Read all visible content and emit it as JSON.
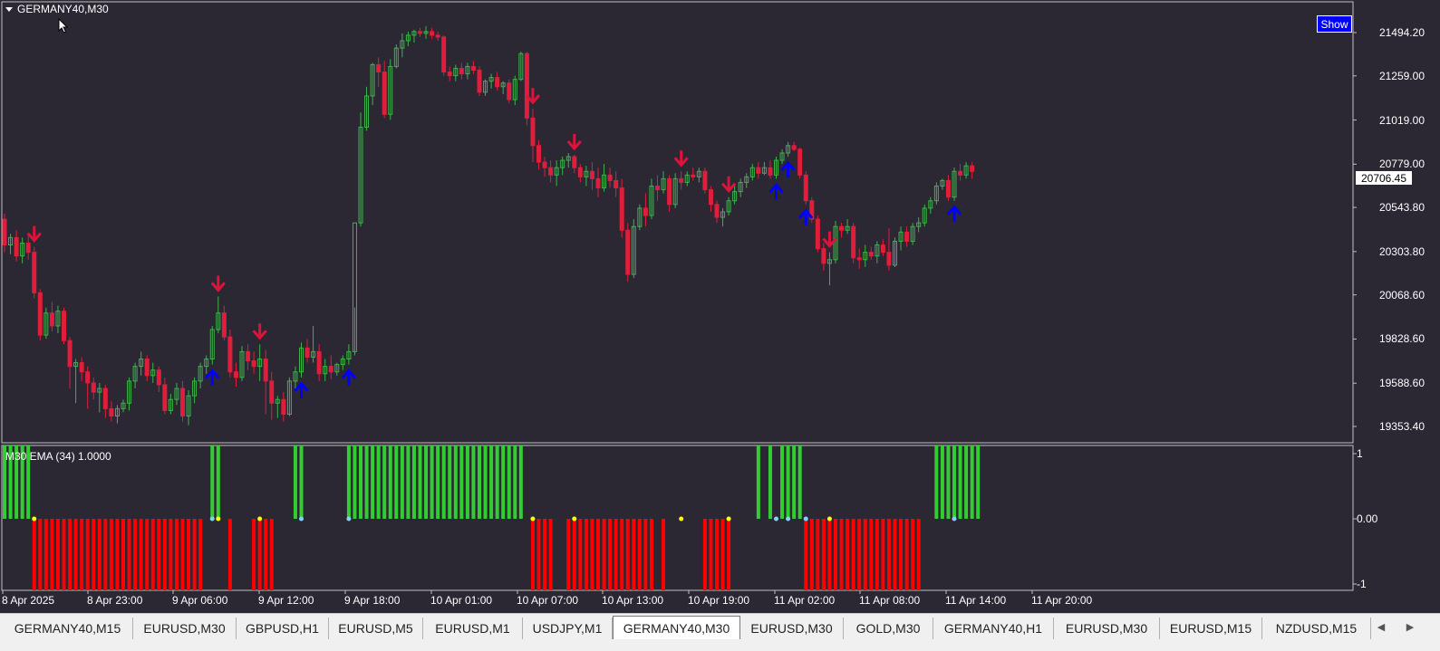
{
  "main_chart": {
    "symbol_title": "GERMANY40,M30",
    "show_button": "Show",
    "price_labels": [
      "21494.20",
      "21259.00",
      "21019.00",
      "20779.00",
      "20543.80",
      "20303.80",
      "20068.60",
      "19828.60",
      "19588.60",
      "19353.40"
    ],
    "current_price": "20706.45",
    "bull_color": "#3cb44b",
    "bear_color": "#e01e3c",
    "arrow_down_color": "#dc143c",
    "arrow_up_color": "#0000ff"
  },
  "indicator": {
    "title": "M30 EMA (34) 1.0000",
    "labels": [
      "1",
      "0.00",
      "-1"
    ],
    "green_color": "#32cd32",
    "red_color": "#ff0000"
  },
  "time_axis": [
    "8 Apr 2025",
    "8 Apr 23:00",
    "9 Apr 06:00",
    "9 Apr 12:00",
    "9 Apr 18:00",
    "10 Apr 01:00",
    "10 Apr 07:00",
    "10 Apr 13:00",
    "10 Apr 19:00",
    "11 Apr 02:00",
    "11 Apr 08:00",
    "11 Apr 14:00",
    "11 Apr 20:00"
  ],
  "tabs": [
    {
      "label": "GERMANY40,M15",
      "active": false
    },
    {
      "label": "EURUSD,M30",
      "active": false
    },
    {
      "label": "GBPUSD,H1",
      "active": false
    },
    {
      "label": "EURUSD,M5",
      "active": false
    },
    {
      "label": "EURUSD,M1",
      "active": false
    },
    {
      "label": "USDJPY,M1",
      "active": false
    },
    {
      "label": "GERMANY40,M30",
      "active": true
    },
    {
      "label": "EURUSD,M30",
      "active": false
    },
    {
      "label": "GOLD,M30",
      "active": false
    },
    {
      "label": "GERMANY40,H1",
      "active": false
    },
    {
      "label": "EURUSD,M30",
      "active": false
    },
    {
      "label": "EURUSD,M15",
      "active": false
    },
    {
      "label": "NZDUSD,M15",
      "active": false
    }
  ],
  "candles": [
    [
      20480,
      20510,
      20300,
      20340
    ],
    [
      20340,
      20400,
      20290,
      20380
    ],
    [
      20380,
      20420,
      20250,
      20280
    ],
    [
      20280,
      20380,
      20240,
      20350
    ],
    [
      20350,
      20400,
      20260,
      20300
    ],
    [
      20300,
      20330,
      20050,
      20080
    ],
    [
      20080,
      20100,
      19820,
      19850
    ],
    [
      19850,
      20000,
      19830,
      19970
    ],
    [
      19970,
      20030,
      19870,
      19900
    ],
    [
      19900,
      20010,
      19860,
      19980
    ],
    [
      19980,
      20000,
      19800,
      19820
    ],
    [
      19820,
      19840,
      19560,
      19680
    ],
    [
      19680,
      19720,
      19480,
      19700
    ],
    [
      19700,
      19730,
      19600,
      19650
    ],
    [
      19650,
      19680,
      19450,
      19590
    ],
    [
      19590,
      19620,
      19500,
      19540
    ],
    [
      19540,
      19590,
      19430,
      19560
    ],
    [
      19560,
      19580,
      19400,
      19450
    ],
    [
      19450,
      19490,
      19380,
      19410
    ],
    [
      19410,
      19470,
      19370,
      19450
    ],
    [
      19450,
      19500,
      19430,
      19480
    ],
    [
      19480,
      19620,
      19440,
      19600
    ],
    [
      19600,
      19700,
      19560,
      19680
    ],
    [
      19680,
      19760,
      19630,
      19720
    ],
    [
      19720,
      19740,
      19600,
      19630
    ],
    [
      19630,
      19700,
      19590,
      19660
    ],
    [
      19660,
      19680,
      19540,
      19580
    ],
    [
      19580,
      19620,
      19420,
      19440
    ],
    [
      19440,
      19530,
      19420,
      19500
    ],
    [
      19500,
      19590,
      19470,
      19560
    ],
    [
      19560,
      19600,
      19380,
      19410
    ],
    [
      19410,
      19550,
      19360,
      19520
    ],
    [
      19520,
      19620,
      19480,
      19600
    ],
    [
      19600,
      19700,
      19560,
      19680
    ],
    [
      19680,
      19740,
      19640,
      19720
    ],
    [
      19720,
      19900,
      19690,
      19880
    ],
    [
      19880,
      20060,
      19860,
      19970
    ],
    [
      19970,
      20010,
      19820,
      19840
    ],
    [
      19840,
      19880,
      19620,
      19650
    ],
    [
      19650,
      19700,
      19570,
      19620
    ],
    [
      19620,
      19790,
      19600,
      19760
    ],
    [
      19760,
      19800,
      19660,
      19710
    ],
    [
      19710,
      19760,
      19640,
      19680
    ],
    [
      19680,
      19800,
      19600,
      19720
    ],
    [
      19720,
      19770,
      19420,
      19600
    ],
    [
      19600,
      19650,
      19390,
      19480
    ],
    [
      19480,
      19520,
      19400,
      19500
    ],
    [
      19500,
      19540,
      19380,
      19420
    ],
    [
      19420,
      19620,
      19410,
      19600
    ],
    [
      19600,
      19680,
      19560,
      19650
    ],
    [
      19650,
      19810,
      19620,
      19780
    ],
    [
      19780,
      19830,
      19700,
      19730
    ],
    [
      19730,
      19900,
      19700,
      19760
    ],
    [
      19760,
      19800,
      19600,
      19640
    ],
    [
      19640,
      19720,
      19600,
      19680
    ],
    [
      19680,
      19740,
      19610,
      19650
    ],
    [
      19650,
      19700,
      19630,
      19690
    ],
    [
      19690,
      19740,
      19660,
      19720
    ],
    [
      19720,
      19800,
      19690,
      19760
    ],
    [
      19760,
      20000,
      19740,
      20460
    ],
    [
      20460,
      21060,
      20440,
      20980
    ],
    [
      20980,
      21200,
      20960,
      21150
    ],
    [
      21150,
      21330,
      21100,
      21320
    ],
    [
      21320,
      21360,
      21200,
      21280
    ],
    [
      21280,
      21340,
      21030,
      21050
    ],
    [
      21050,
      21350,
      21020,
      21310
    ],
    [
      21310,
      21430,
      21300,
      21410
    ],
    [
      21410,
      21490,
      21360,
      21450
    ],
    [
      21450,
      21500,
      21420,
      21480
    ],
    [
      21480,
      21510,
      21440,
      21500
    ],
    [
      21500,
      21520,
      21470,
      21490
    ],
    [
      21490,
      21530,
      21460,
      21500
    ],
    [
      21500,
      21520,
      21460,
      21480
    ],
    [
      21480,
      21500,
      21450,
      21470
    ],
    [
      21470,
      21480,
      21260,
      21280
    ],
    [
      21280,
      21310,
      21230,
      21260
    ],
    [
      21260,
      21320,
      21230,
      21300
    ],
    [
      21300,
      21330,
      21240,
      21270
    ],
    [
      21270,
      21330,
      21240,
      21310
    ],
    [
      21310,
      21340,
      21270,
      21290
    ],
    [
      21290,
      21310,
      21150,
      21170
    ],
    [
      21170,
      21240,
      21150,
      21230
    ],
    [
      21230,
      21270,
      21190,
      21250
    ],
    [
      21250,
      21280,
      21180,
      21200
    ],
    [
      21200,
      21230,
      21160,
      21220
    ],
    [
      21220,
      21240,
      21110,
      21130
    ],
    [
      21130,
      21260,
      21100,
      21240
    ],
    [
      21240,
      21390,
      21230,
      21380
    ],
    [
      21380,
      21390,
      20990,
      21030
    ],
    [
      21030,
      21080,
      20790,
      20880
    ],
    [
      20880,
      20910,
      20750,
      20790
    ],
    [
      20790,
      20820,
      20710,
      20760
    ],
    [
      20760,
      20800,
      20680,
      20720
    ],
    [
      20720,
      20800,
      20660,
      20760
    ],
    [
      20760,
      20820,
      20720,
      20800
    ],
    [
      20800,
      20840,
      20760,
      20820
    ],
    [
      20820,
      20830,
      20730,
      20760
    ],
    [
      20760,
      20780,
      20680,
      20710
    ],
    [
      20710,
      20770,
      20660,
      20740
    ],
    [
      20740,
      20790,
      20640,
      20700
    ],
    [
      20700,
      20760,
      20600,
      20650
    ],
    [
      20650,
      20780,
      20630,
      20720
    ],
    [
      20720,
      20760,
      20650,
      20690
    ],
    [
      20690,
      20740,
      20600,
      20650
    ],
    [
      20650,
      20700,
      20380,
      20420
    ],
    [
      20420,
      20460,
      20140,
      20180
    ],
    [
      20180,
      20480,
      20160,
      20440
    ],
    [
      20440,
      20560,
      20420,
      20540
    ],
    [
      20540,
      20620,
      20440,
      20500
    ],
    [
      20500,
      20700,
      20480,
      20660
    ],
    [
      20660,
      20720,
      20580,
      20640
    ],
    [
      20640,
      20740,
      20620,
      20700
    ],
    [
      20700,
      20720,
      20520,
      20560
    ],
    [
      20560,
      20730,
      20540,
      20700
    ],
    [
      20700,
      20740,
      20640,
      20680
    ],
    [
      20680,
      20740,
      20660,
      20720
    ],
    [
      20720,
      20760,
      20690,
      20710
    ],
    [
      20710,
      20760,
      20680,
      20740
    ],
    [
      20740,
      20760,
      20620,
      20640
    ],
    [
      20640,
      20660,
      20520,
      20560
    ],
    [
      20560,
      20580,
      20460,
      20490
    ],
    [
      20490,
      20540,
      20440,
      20520
    ],
    [
      20520,
      20600,
      20500,
      20580
    ],
    [
      20580,
      20660,
      20560,
      20630
    ],
    [
      20630,
      20700,
      20600,
      20680
    ],
    [
      20680,
      20730,
      20650,
      20710
    ],
    [
      20710,
      20780,
      20690,
      20760
    ],
    [
      20760,
      20790,
      20700,
      20730
    ],
    [
      20730,
      20790,
      20720,
      20760
    ],
    [
      20760,
      20800,
      20700,
      20720
    ],
    [
      20720,
      20820,
      20700,
      20800
    ],
    [
      20800,
      20860,
      20780,
      20840
    ],
    [
      20840,
      20900,
      20820,
      20880
    ],
    [
      20880,
      20900,
      20850,
      20860
    ],
    [
      20860,
      20870,
      20700,
      20720
    ],
    [
      20720,
      20740,
      20560,
      20580
    ],
    [
      20580,
      20600,
      20460,
      20480
    ],
    [
      20480,
      20500,
      20300,
      20320
    ],
    [
      20320,
      20350,
      20200,
      20240
    ],
    [
      20240,
      20300,
      20120,
      20260
    ],
    [
      20260,
      20470,
      20240,
      20440
    ],
    [
      20440,
      20460,
      20380,
      20420
    ],
    [
      20420,
      20480,
      20400,
      20440
    ],
    [
      20440,
      20460,
      20240,
      20270
    ],
    [
      20270,
      20320,
      20210,
      20260
    ],
    [
      20260,
      20340,
      20220,
      20300
    ],
    [
      20300,
      20330,
      20260,
      20280
    ],
    [
      20280,
      20360,
      20240,
      20340
    ],
    [
      20340,
      20370,
      20280,
      20300
    ],
    [
      20300,
      20430,
      20200,
      20230
    ],
    [
      20230,
      20380,
      20220,
      20360
    ],
    [
      20360,
      20440,
      20310,
      20410
    ],
    [
      20410,
      20440,
      20330,
      20360
    ],
    [
      20360,
      20460,
      20340,
      20440
    ],
    [
      20440,
      20490,
      20410,
      20460
    ],
    [
      20460,
      20560,
      20440,
      20540
    ],
    [
      20540,
      20600,
      20510,
      20580
    ],
    [
      20580,
      20680,
      20560,
      20660
    ],
    [
      20660,
      20700,
      20640,
      20690
    ],
    [
      20690,
      20720,
      20580,
      20600
    ],
    [
      20600,
      20760,
      20580,
      20740
    ],
    [
      20740,
      20780,
      20690,
      20720
    ],
    [
      20720,
      20790,
      20700,
      20770
    ],
    [
      20770,
      20790,
      20700,
      20740
    ]
  ],
  "arrows": [
    {
      "i": 5,
      "dir": "down"
    },
    {
      "i": 36,
      "dir": "down"
    },
    {
      "i": 43,
      "dir": "down"
    },
    {
      "i": 35,
      "dir": "up"
    },
    {
      "i": 50,
      "dir": "up"
    },
    {
      "i": 58,
      "dir": "up"
    },
    {
      "i": 89,
      "dir": "down"
    },
    {
      "i": 96,
      "dir": "down"
    },
    {
      "i": 114,
      "dir": "down"
    },
    {
      "i": 122,
      "dir": "down"
    },
    {
      "i": 130,
      "dir": "up"
    },
    {
      "i": 132,
      "dir": "up"
    },
    {
      "i": 135,
      "dir": "up"
    },
    {
      "i": 139,
      "dir": "down"
    },
    {
      "i": 160,
      "dir": "up"
    }
  ],
  "histogram": [
    1,
    1,
    1,
    1,
    1,
    -1,
    -1,
    -1,
    -1,
    -1,
    -1,
    -1,
    -1,
    -1,
    -1,
    -1,
    -1,
    -1,
    -1,
    -1,
    -1,
    -1,
    -1,
    -1,
    -1,
    -1,
    -1,
    -1,
    -1,
    -1,
    -1,
    -1,
    -1,
    -1,
    0,
    1,
    1,
    0,
    -1,
    0,
    0,
    0,
    -1,
    -1,
    -1,
    -1,
    0,
    0,
    0,
    1,
    1,
    0,
    0,
    0,
    0,
    0,
    0,
    0,
    1,
    1,
    1,
    1,
    1,
    1,
    1,
    1,
    1,
    1,
    1,
    1,
    1,
    1,
    1,
    1,
    1,
    1,
    1,
    1,
    1,
    1,
    1,
    1,
    1,
    1,
    1,
    1,
    1,
    1,
    0,
    -1,
    -1,
    -1,
    -1,
    0,
    0,
    -1,
    -1,
    -1,
    -1,
    -1,
    -1,
    -1,
    -1,
    -1,
    -1,
    -1,
    -1,
    -1,
    -1,
    -1,
    0,
    -1,
    0,
    0,
    0,
    0,
    0,
    0,
    -1,
    -1,
    -1,
    -1,
    -1,
    0,
    0,
    0,
    0,
    1,
    0,
    1,
    0,
    1,
    1,
    1,
    1,
    -1,
    -1,
    -1,
    -1,
    -1,
    -1,
    -1,
    -1,
    -1,
    -1,
    -1,
    -1,
    -1,
    -1,
    -1,
    -1,
    -1,
    -1,
    -1,
    -1,
    0,
    0,
    1,
    1,
    1,
    1,
    1,
    1,
    1,
    1
  ]
}
